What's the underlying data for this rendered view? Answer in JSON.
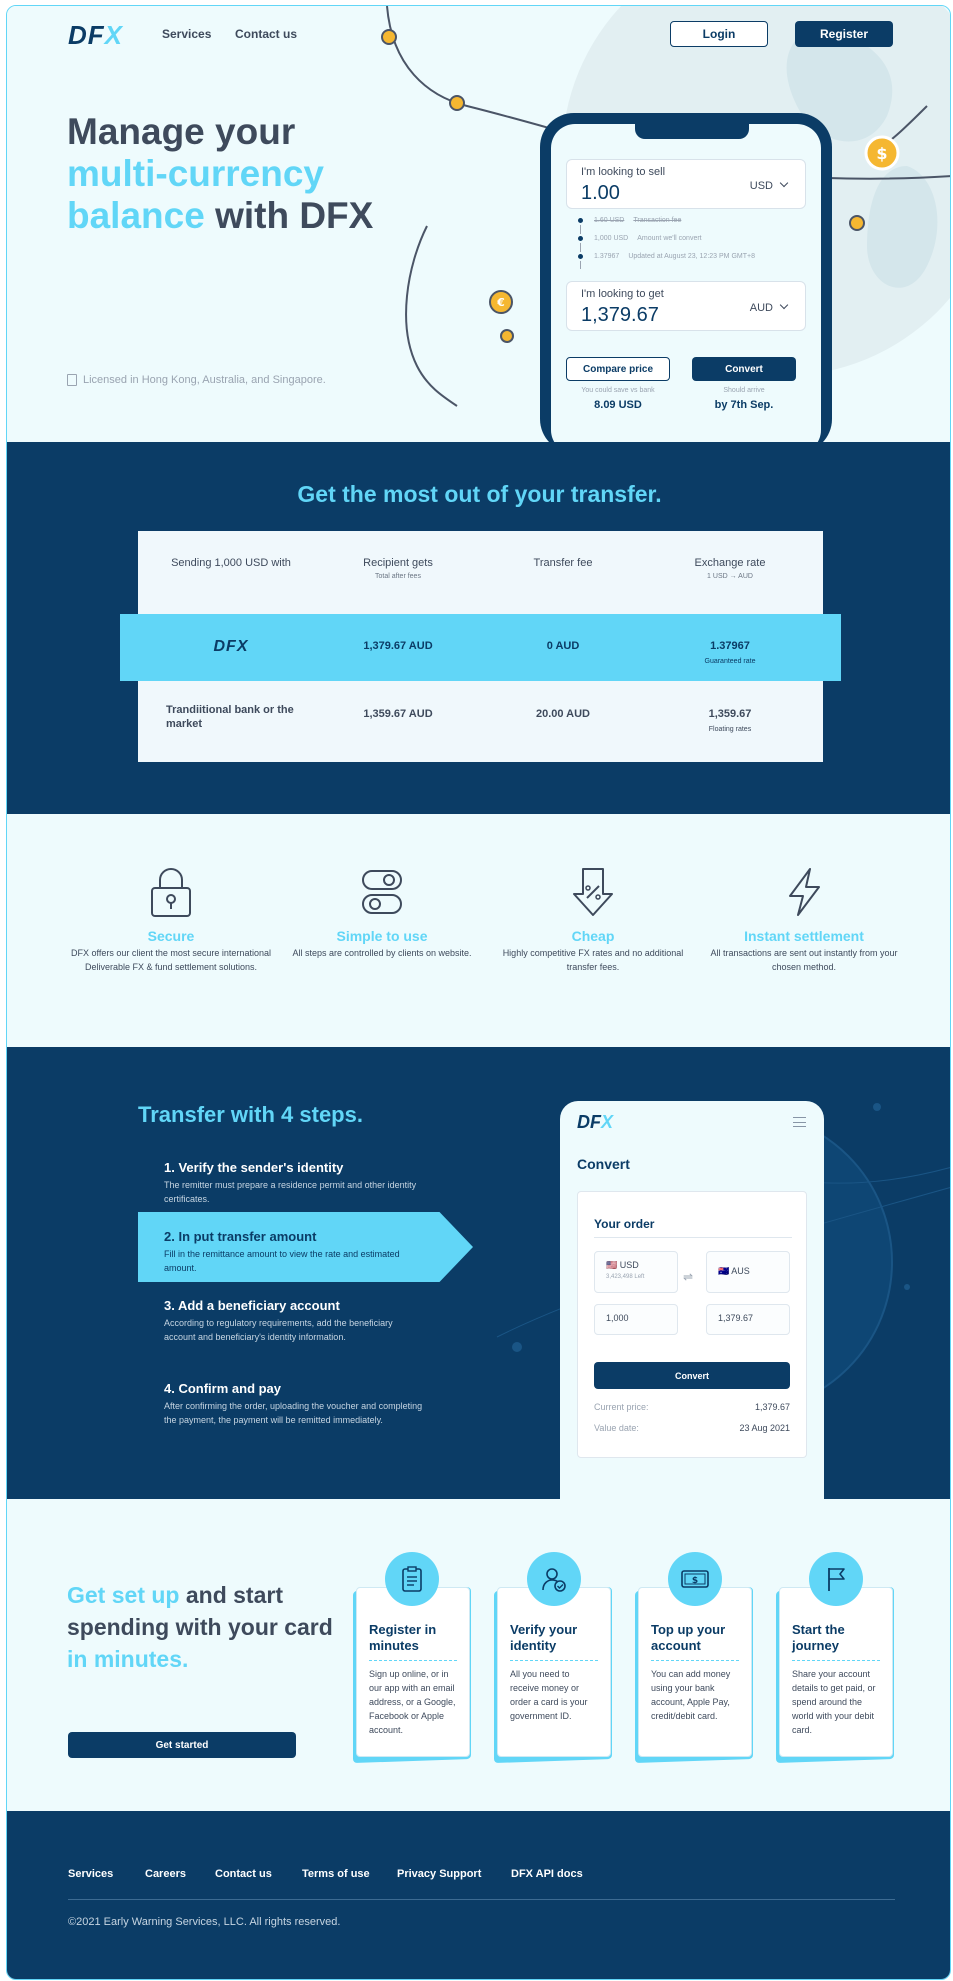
{
  "nav": {
    "logo_main": "DF",
    "logo_accent": "X",
    "links": [
      "Services",
      "Contact us"
    ],
    "login": "Login",
    "register": "Register"
  },
  "hero": {
    "title_1": "Manage your",
    "title_2": "multi-currency",
    "title_3a": "balance",
    "title_3b": " with DFX",
    "license": "Licensed in Hong Kong, Australia, and Singapore."
  },
  "converter": {
    "sell_label": "I'm looking to sell",
    "sell_value": "1.00",
    "sell_currency": "USD",
    "fee_value": "1.60 USD",
    "fee_label": "Transaction fee",
    "convert_value": "1,000 USD",
    "convert_label": "Amount we'll convert",
    "rate_value": "1.37967",
    "rate_label": "Updated at August 23, 12:23 PM GMT+8",
    "get_label": "I'm looking to get",
    "get_value": "1,379.67",
    "get_currency": "AUD",
    "compare_button": "Compare price",
    "convert_button": "Convert",
    "save_caption": "You could save vs bank",
    "save_value": "8.09 USD",
    "arrive_caption": "Should arrive",
    "arrive_value": "by 7th Sep."
  },
  "comparison": {
    "title": "Get the most out of your transfer.",
    "headers": {
      "sending": "Sending 1,000 USD with",
      "recipient": "Recipient gets",
      "recipient_sub": "Total after fees",
      "fee": "Transfer fee",
      "rate": "Exchange rate",
      "rate_sub": "1 USD → AUD"
    },
    "dfx_row": {
      "name": "DFX",
      "recipient": "1,379.67 AUD",
      "fee": "0 AUD",
      "rate": "1.37967",
      "rate_sub": "Guaranteed rate"
    },
    "bank_row": {
      "name": "Trandiitional bank or the market",
      "recipient": "1,359.67 AUD",
      "fee": "20.00 AUD",
      "rate": "1,359.67",
      "rate_sub": "Floating rates"
    }
  },
  "features": [
    {
      "title": "Secure",
      "text": "DFX offers our client the most secure international Deliverable FX & fund settlement solutions.",
      "icon": "lock-icon"
    },
    {
      "title": "Simple to use",
      "text": "All steps are controlled by clients on website.",
      "icon": "toggle-icon"
    },
    {
      "title": "Cheap",
      "text": "Highly competitive FX rates and no additional transfer fees.",
      "icon": "discount-tag-icon"
    },
    {
      "title": "Instant settlement",
      "text": "All transactions are sent out instantly from your chosen method.",
      "icon": "lightning-icon"
    }
  ],
  "steps": {
    "title": "Transfer with 4 steps.",
    "items": [
      {
        "title": "1. Verify the sender's identity",
        "text": "The remitter must prepare a residence permit and other identity certificates."
      },
      {
        "title": "2. In put transfer amount",
        "text": "Fill in the remittance amount to view the rate and estimated amount."
      },
      {
        "title": "3. Add a beneficiary account",
        "text": "According to regulatory requirements, add the beneficiary account and beneficiary's identity information."
      },
      {
        "title": "4. Confirm and pay",
        "text": "After confirming the order, uploading the voucher and completing the payment, the payment will be remitted immediately."
      }
    ]
  },
  "mobile": {
    "logo_main": "DF",
    "logo_accent": "X",
    "heading": "Convert",
    "order_title": "Your order",
    "from_currency": "🇺🇸 USD",
    "from_balance": "3,423,498 Left",
    "to_currency": "🇦🇺 AUS",
    "from_amount": "1,000",
    "to_amount": "1,379.67",
    "convert_button": "Convert",
    "price_label": "Current price:",
    "price_value": "1,379.67",
    "date_label": "Value date:",
    "date_value": "23 Aug 2021"
  },
  "start": {
    "title_1a": "Get set up",
    "title_1b": " and start spending with your card ",
    "title_2": "in minutes.",
    "button": "Get started",
    "cards": [
      {
        "title": "Register in minutes",
        "text": "Sign up online, or in our app with an email address, or a Google, Facebook or Apple account.",
        "icon": "clipboard-icon"
      },
      {
        "title": "Verify your identity",
        "text": "All you need to receive money or order a card is your government ID.",
        "icon": "user-check-icon"
      },
      {
        "title": "Top up your account",
        "text": "You can add money using your bank account, Apple Pay, credit/debit card.",
        "icon": "banknote-icon"
      },
      {
        "title": "Start the journey",
        "text": "Share your account details to get paid, or spend around the world with your debit card.",
        "icon": "flag-icon"
      }
    ]
  },
  "footer": {
    "links": [
      "Services",
      "Careers",
      "Contact us",
      "Terms of use",
      "Privacy Support",
      "DFX API docs"
    ],
    "copyright": "©2021 Early Warning Services, LLC. All rights reserved."
  },
  "colors": {
    "navy": "#0b3c66",
    "cyan": "#61d6f7",
    "background": "#eefbfd",
    "coin": "#f5b731"
  }
}
